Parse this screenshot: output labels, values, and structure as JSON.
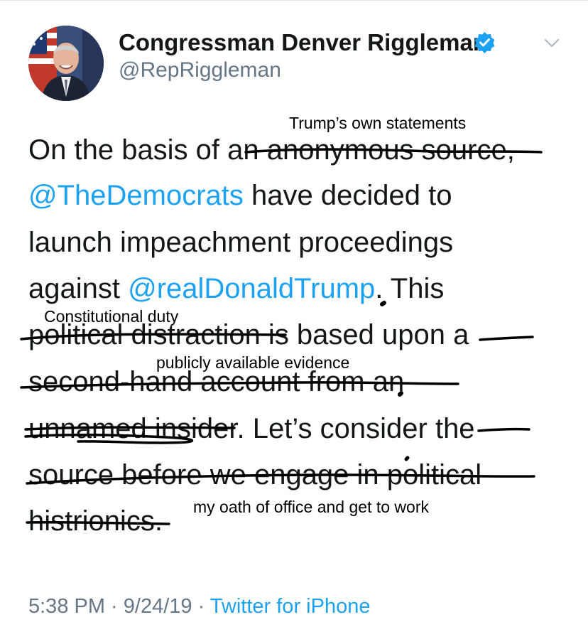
{
  "tweet": {
    "author_name": "Congressman Denver Riggleman",
    "handle": "@RepRiggleman",
    "lines": {
      "l1": "On the basis of an anonymous source,",
      "l2_mention": "@TheDemocrats",
      "l2_rest": " have decided to",
      "l3": "launch impeachment proceedings",
      "l4_start": "against ",
      "l4_mention": "@realDonaldTrump",
      "l4_end": ". This",
      "l5": "political distraction is based upon a",
      "l6": "second-hand account from an",
      "l7": "unnamed insider. Let’s consider the",
      "l8": "source before we engage in political",
      "l9": "histrionics."
    },
    "time": "5:38 PM",
    "separator": " · ",
    "date": "9/24/19",
    "source": "Twitter for iPhone"
  },
  "annotations": {
    "a1": "Trump’s own statements",
    "a2": "Constitutional duty",
    "a3": "publicly available evidence",
    "a4": "my oath of office and get to work"
  },
  "icons": {
    "verified": "verified-badge-icon",
    "menu": "chevron-down-icon"
  },
  "colors": {
    "link": "#1da1f2",
    "secondary": "#657786",
    "text": "#14171a"
  }
}
